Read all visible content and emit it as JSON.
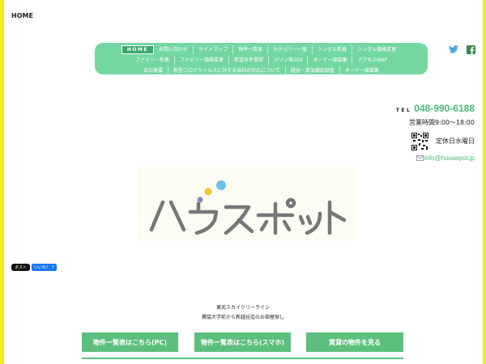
{
  "header": {
    "home_label": "HOME"
  },
  "nav": {
    "rows": [
      [
        "HOME",
        "お問い合わせ",
        "サイトマップ",
        "物件一覧表",
        "カテゴリー一覧",
        "シングル新着",
        "シングル価格変更"
      ],
      [
        "ファミリー新着",
        "ファミリー価格変更",
        "希望条件登録",
        "メゾン寿102",
        "オーナー様募集",
        "アクセスMAP"
      ],
      [
        "会社概要",
        "新型コロナウイルスに対する当社の対応について",
        "越谷・草加徹底調査",
        "オーナー様募集"
      ]
    ],
    "active": "HOME"
  },
  "social": {
    "twitter_icon": "twitter-icon",
    "facebook_icon": "facebook-icon"
  },
  "contact": {
    "tel_prefix": "TEL",
    "tel": "048-990-6188",
    "hours": "営業時間9:00～18:00",
    "closed": "定休日水曜日",
    "email": "info@housepot.jp"
  },
  "logo": {
    "text": "ハウスポット"
  },
  "share": {
    "x_label": "ポスト",
    "fb_label": "いいね！ 7"
  },
  "tagline": {
    "line1": "東武スカイツリーライン",
    "line2": "獨協大学前から新越谷迄のお部屋探し"
  },
  "cta": {
    "pc": "物件一覧表はこちら(PC)",
    "sp": "物件一覧表はこちら(スマホ)",
    "rent": "賃貸の物件を見る"
  },
  "colors": {
    "accent": "#74d7a2",
    "button": "#5cbf7e",
    "text_green": "#48b877",
    "edge": "#f2ea1c"
  }
}
